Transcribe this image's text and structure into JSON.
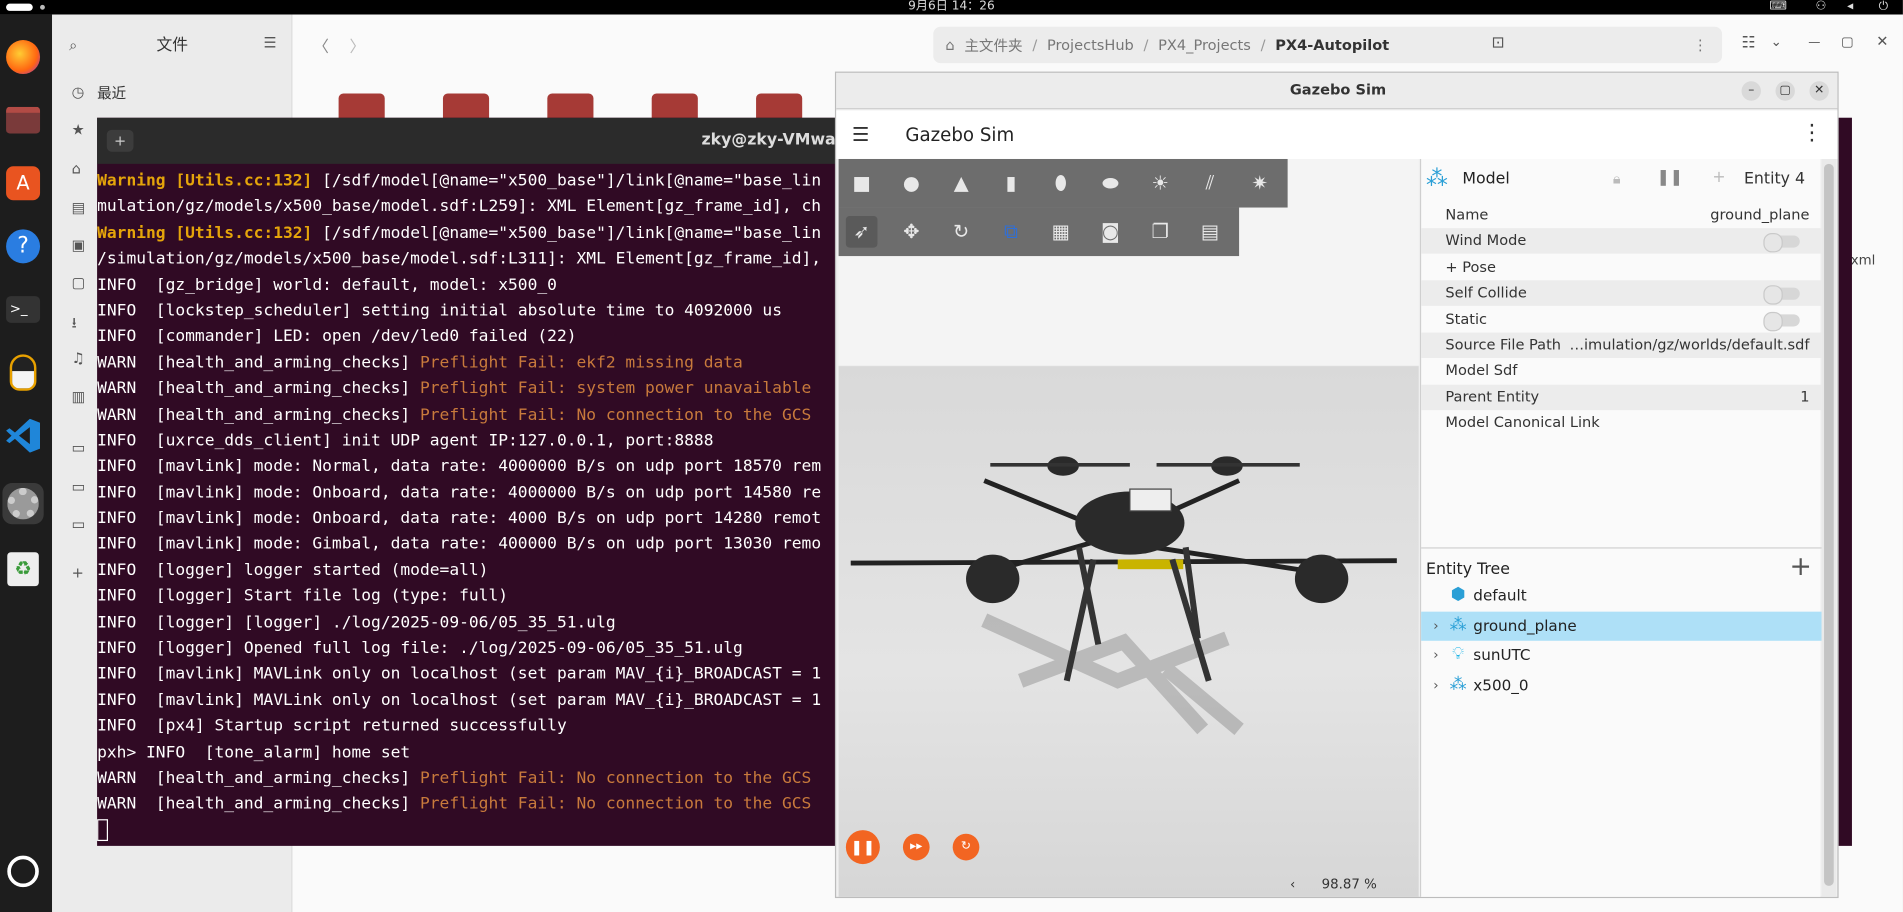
{
  "topbar": {
    "clock": "9月6日  14：26"
  },
  "files": {
    "sidebar_title": "文件",
    "recent": "最近",
    "breadcrumb": [
      "主文件夹",
      "ProjectsHub",
      "PX4_Projects",
      "PX4-Autopilot"
    ],
    "partial_filename": "xml"
  },
  "terminal": {
    "title": "zky@zky-VMware-V",
    "lines": [
      {
        "lvl": "Warning",
        "tag": "[Utils.cc:132]",
        "msg": " [/sdf/model[@name=\"x500_base\"]/link[@name=\"base_lin"
      },
      {
        "lvl": "",
        "tag": "",
        "msg": "mulation/gz/models/x500_base/model.sdf:L259]: XML Element[gz_frame_id], ch"
      },
      {
        "lvl": "Warning",
        "tag": "[Utils.cc:132]",
        "msg": " [/sdf/model[@name=\"x500_base\"]/link[@name=\"base_lin"
      },
      {
        "lvl": "",
        "tag": "",
        "msg": "/simulation/gz/models/x500_base/model.sdf:L311]: XML Element[gz_frame_id],"
      },
      {
        "lvl": "INFO",
        "tag": "[gz_bridge]",
        "msg": " world: default, model: x500_0"
      },
      {
        "lvl": "INFO",
        "tag": "[lockstep_scheduler]",
        "msg": " setting initial absolute time to 4092000 us"
      },
      {
        "lvl": "INFO",
        "tag": "[commander]",
        "msg": " LED: open /dev/led0 failed (22)"
      },
      {
        "lvl": "WARN",
        "tag": "[health_and_arming_checks]",
        "msg": " Preflight Fail: ekf2 missing data"
      },
      {
        "lvl": "WARN",
        "tag": "[health_and_arming_checks]",
        "msg": " Preflight Fail: system power unavailable"
      },
      {
        "lvl": "WARN",
        "tag": "[health_and_arming_checks]",
        "msg": " Preflight Fail: No connection to the GCS"
      },
      {
        "lvl": "INFO",
        "tag": "[uxrce_dds_client]",
        "msg": " init UDP agent IP:127.0.0.1, port:8888"
      },
      {
        "lvl": "INFO",
        "tag": "[mavlink]",
        "msg": " mode: Normal, data rate: 4000000 B/s on udp port 18570 rem"
      },
      {
        "lvl": "INFO",
        "tag": "[mavlink]",
        "msg": " mode: Onboard, data rate: 4000000 B/s on udp port 14580 re"
      },
      {
        "lvl": "INFO",
        "tag": "[mavlink]",
        "msg": " mode: Onboard, data rate: 4000 B/s on udp port 14280 remot"
      },
      {
        "lvl": "INFO",
        "tag": "[mavlink]",
        "msg": " mode: Gimbal, data rate: 400000 B/s on udp port 13030 remo"
      },
      {
        "lvl": "INFO",
        "tag": "[logger]",
        "msg": " logger started (mode=all)"
      },
      {
        "lvl": "INFO",
        "tag": "[logger]",
        "msg": " Start file log (type: full)"
      },
      {
        "lvl": "INFO",
        "tag": "[logger]",
        "msg": " [logger] ./log/2025-09-06/05_35_51.ulg"
      },
      {
        "lvl": "INFO",
        "tag": "[logger]",
        "msg": " Opened full log file: ./log/2025-09-06/05_35_51.ulg"
      },
      {
        "lvl": "INFO",
        "tag": "[mavlink]",
        "msg": " MAVLink only on localhost (set param MAV_{i}_BROADCAST = 1"
      },
      {
        "lvl": "INFO",
        "tag": "[mavlink]",
        "msg": " MAVLink only on localhost (set param MAV_{i}_BROADCAST = 1"
      },
      {
        "lvl": "INFO",
        "tag": "[px4]",
        "msg": " Startup script returned successfully"
      },
      {
        "lvl": "pxh> INFO ",
        "tag": "[tone_alarm]",
        "msg": " home set"
      },
      {
        "lvl": "WARN",
        "tag": "[health_and_arming_checks]",
        "msg": " Preflight Fail: No connection to the GCS"
      },
      {
        "lvl": "WARN",
        "tag": "[health_and_arming_checks]",
        "msg": " Preflight Fail: No connection to the GCS"
      }
    ]
  },
  "gazebo": {
    "window_title": "Gazebo Sim",
    "app_title": "Gazebo Sim",
    "zoom": "98.87 %",
    "component": {
      "label": "Model",
      "entity": "Entity 4",
      "rows": [
        {
          "key": "Name",
          "value": "ground_plane",
          "type": "text"
        },
        {
          "key": "Wind Mode",
          "value": "",
          "type": "toggle"
        },
        {
          "key": "+ Pose",
          "value": "",
          "type": "text"
        },
        {
          "key": "Self Collide",
          "value": "",
          "type": "toggle"
        },
        {
          "key": "Static",
          "value": "",
          "type": "toggle"
        },
        {
          "key": "Source File Path",
          "value": "…imulation/gz/worlds/default.sdf",
          "type": "text"
        },
        {
          "key": "Model Sdf",
          "value": "",
          "type": "text"
        },
        {
          "key": "Parent Entity",
          "value": "1",
          "type": "text"
        },
        {
          "key": "Model Canonical Link",
          "value": "",
          "type": "text"
        }
      ]
    },
    "entity_tree": {
      "label": "Entity Tree",
      "items": [
        {
          "name": "default",
          "icon": "world-icon",
          "expandable": false,
          "selected": false
        },
        {
          "name": "ground_plane",
          "icon": "model-icon",
          "expandable": true,
          "selected": true
        },
        {
          "name": "sunUTC",
          "icon": "light-icon",
          "expandable": true,
          "selected": false
        },
        {
          "name": "x500_0",
          "icon": "model-icon",
          "expandable": true,
          "selected": false
        }
      ]
    }
  }
}
